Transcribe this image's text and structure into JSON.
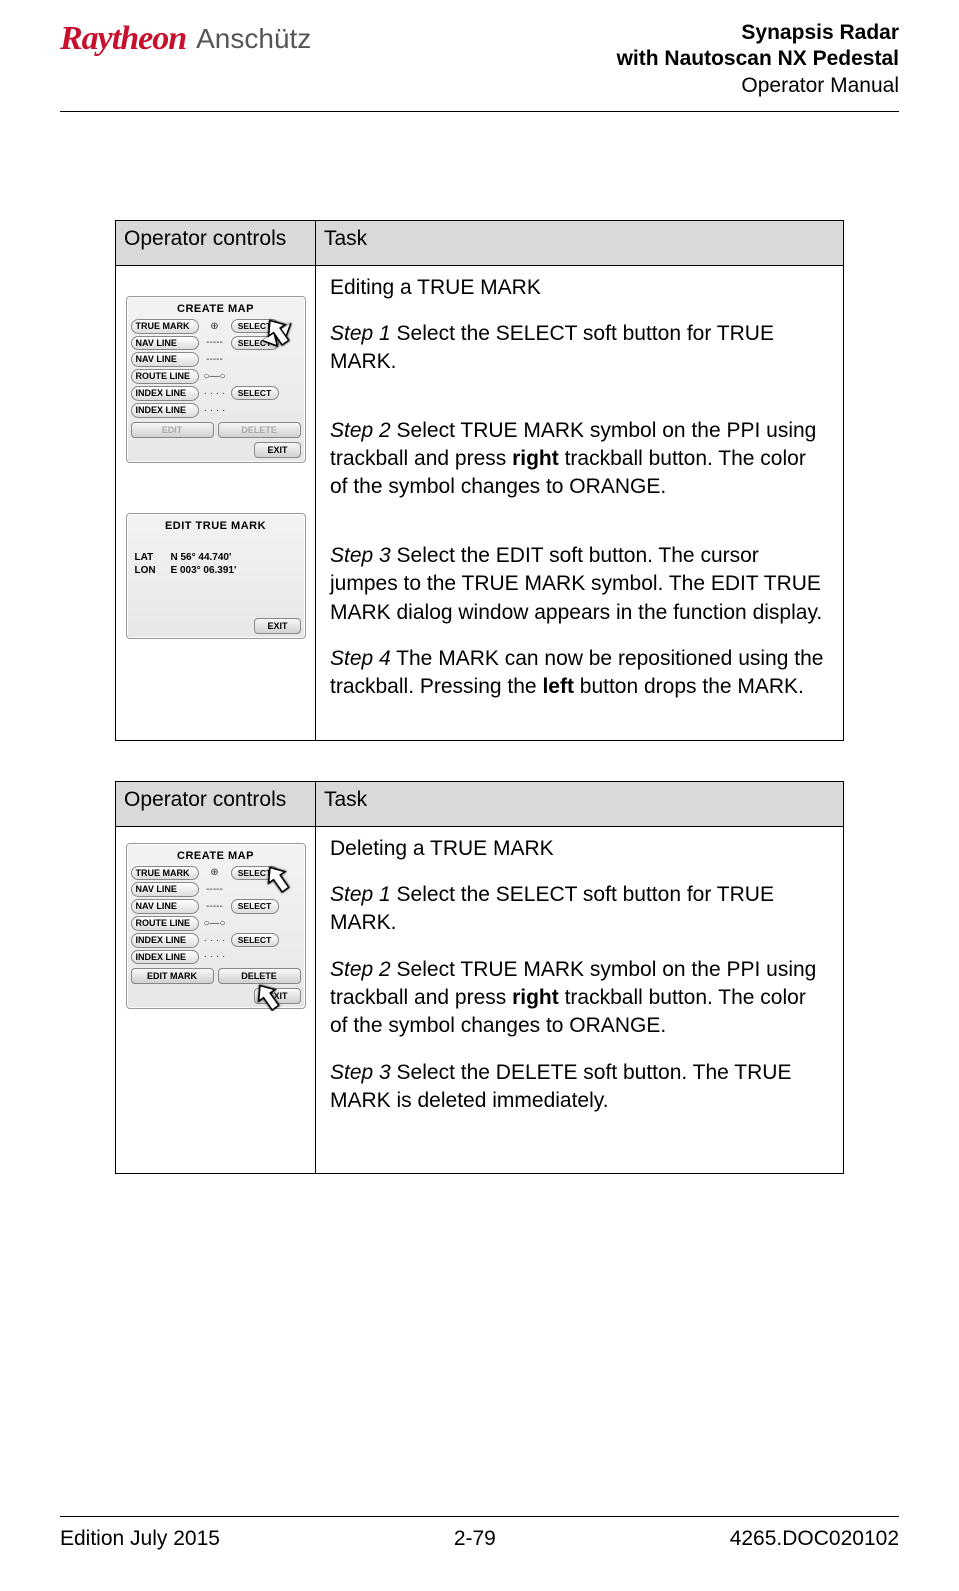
{
  "header": {
    "logo_raytheon": "Raytheon",
    "logo_anschutz": "Anschütz",
    "title_line1": "Synapsis Radar",
    "title_line2": "with Nautoscan NX Pedestal",
    "title_line3": "Operator Manual"
  },
  "tables": {
    "col1_header": "Operator controls",
    "col2_header": "Task",
    "edit": {
      "title": "Editing a TRUE MARK",
      "step1_label": "Step 1",
      "step1_text": " Select the SELECT soft button for TRUE MARK.",
      "step2_label": "Step 2",
      "step2_a": " Select TRUE MARK symbol on the PPI using trackball and   press ",
      "step2_bold": "right",
      "step2_b": " trackball button. The color of the symbol changes to ORANGE.",
      "step3_label": "Step 3",
      "step3_text": " Select the EDIT soft button. The cursor jumpes to the TRUE MARK symbol. The EDIT TRUE MARK dialog window appears in the function display.",
      "step4_label": "Step 4",
      "step4_a": " The MARK can now be repositioned using the trackball. Pressing the ",
      "step4_bold": "left",
      "step4_b": " button drops the MARK."
    },
    "delete": {
      "title": "Deleting a TRUE MARK",
      "step1_label": "Step 1",
      "step1_text": " Select the SELECT soft button for TRUE MARK.",
      "step2_label": "Step 2",
      "step2_a": " Select TRUE MARK symbol on the PPI using trackball and press ",
      "step2_bold": "right",
      "step2_b": " trackball button. The color of the symbol changes to ORANGE.",
      "step3_label": "Step 3",
      "step3_text": " Select the DELETE soft button. The TRUE MARK is deleted immediately."
    }
  },
  "ui": {
    "create_map_title": "CREATE MAP",
    "edit_true_mark_title": "EDIT TRUE MARK",
    "rows": {
      "true_mark": "TRUE MARK",
      "nav_line": "NAV LINE",
      "route_line": "ROUTE LINE",
      "index_line": "INDEX LINE",
      "edit_mark": "EDIT MARK"
    },
    "symbols": {
      "oplus": "⊕",
      "dash": "-----",
      "circle": "○—○",
      "dots": "· · · ·"
    },
    "select": "SELECT",
    "edit": "EDIT",
    "delete": "DELETE",
    "exit": "EXIT",
    "lat_lbl": "LAT",
    "lon_lbl": "LON",
    "lat_val": "N 56° 44.740'",
    "lon_val": "E 003° 06.391'"
  },
  "footer": {
    "left": "Edition July 2015",
    "center": "2-79",
    "right": "4265.DOC020102"
  }
}
